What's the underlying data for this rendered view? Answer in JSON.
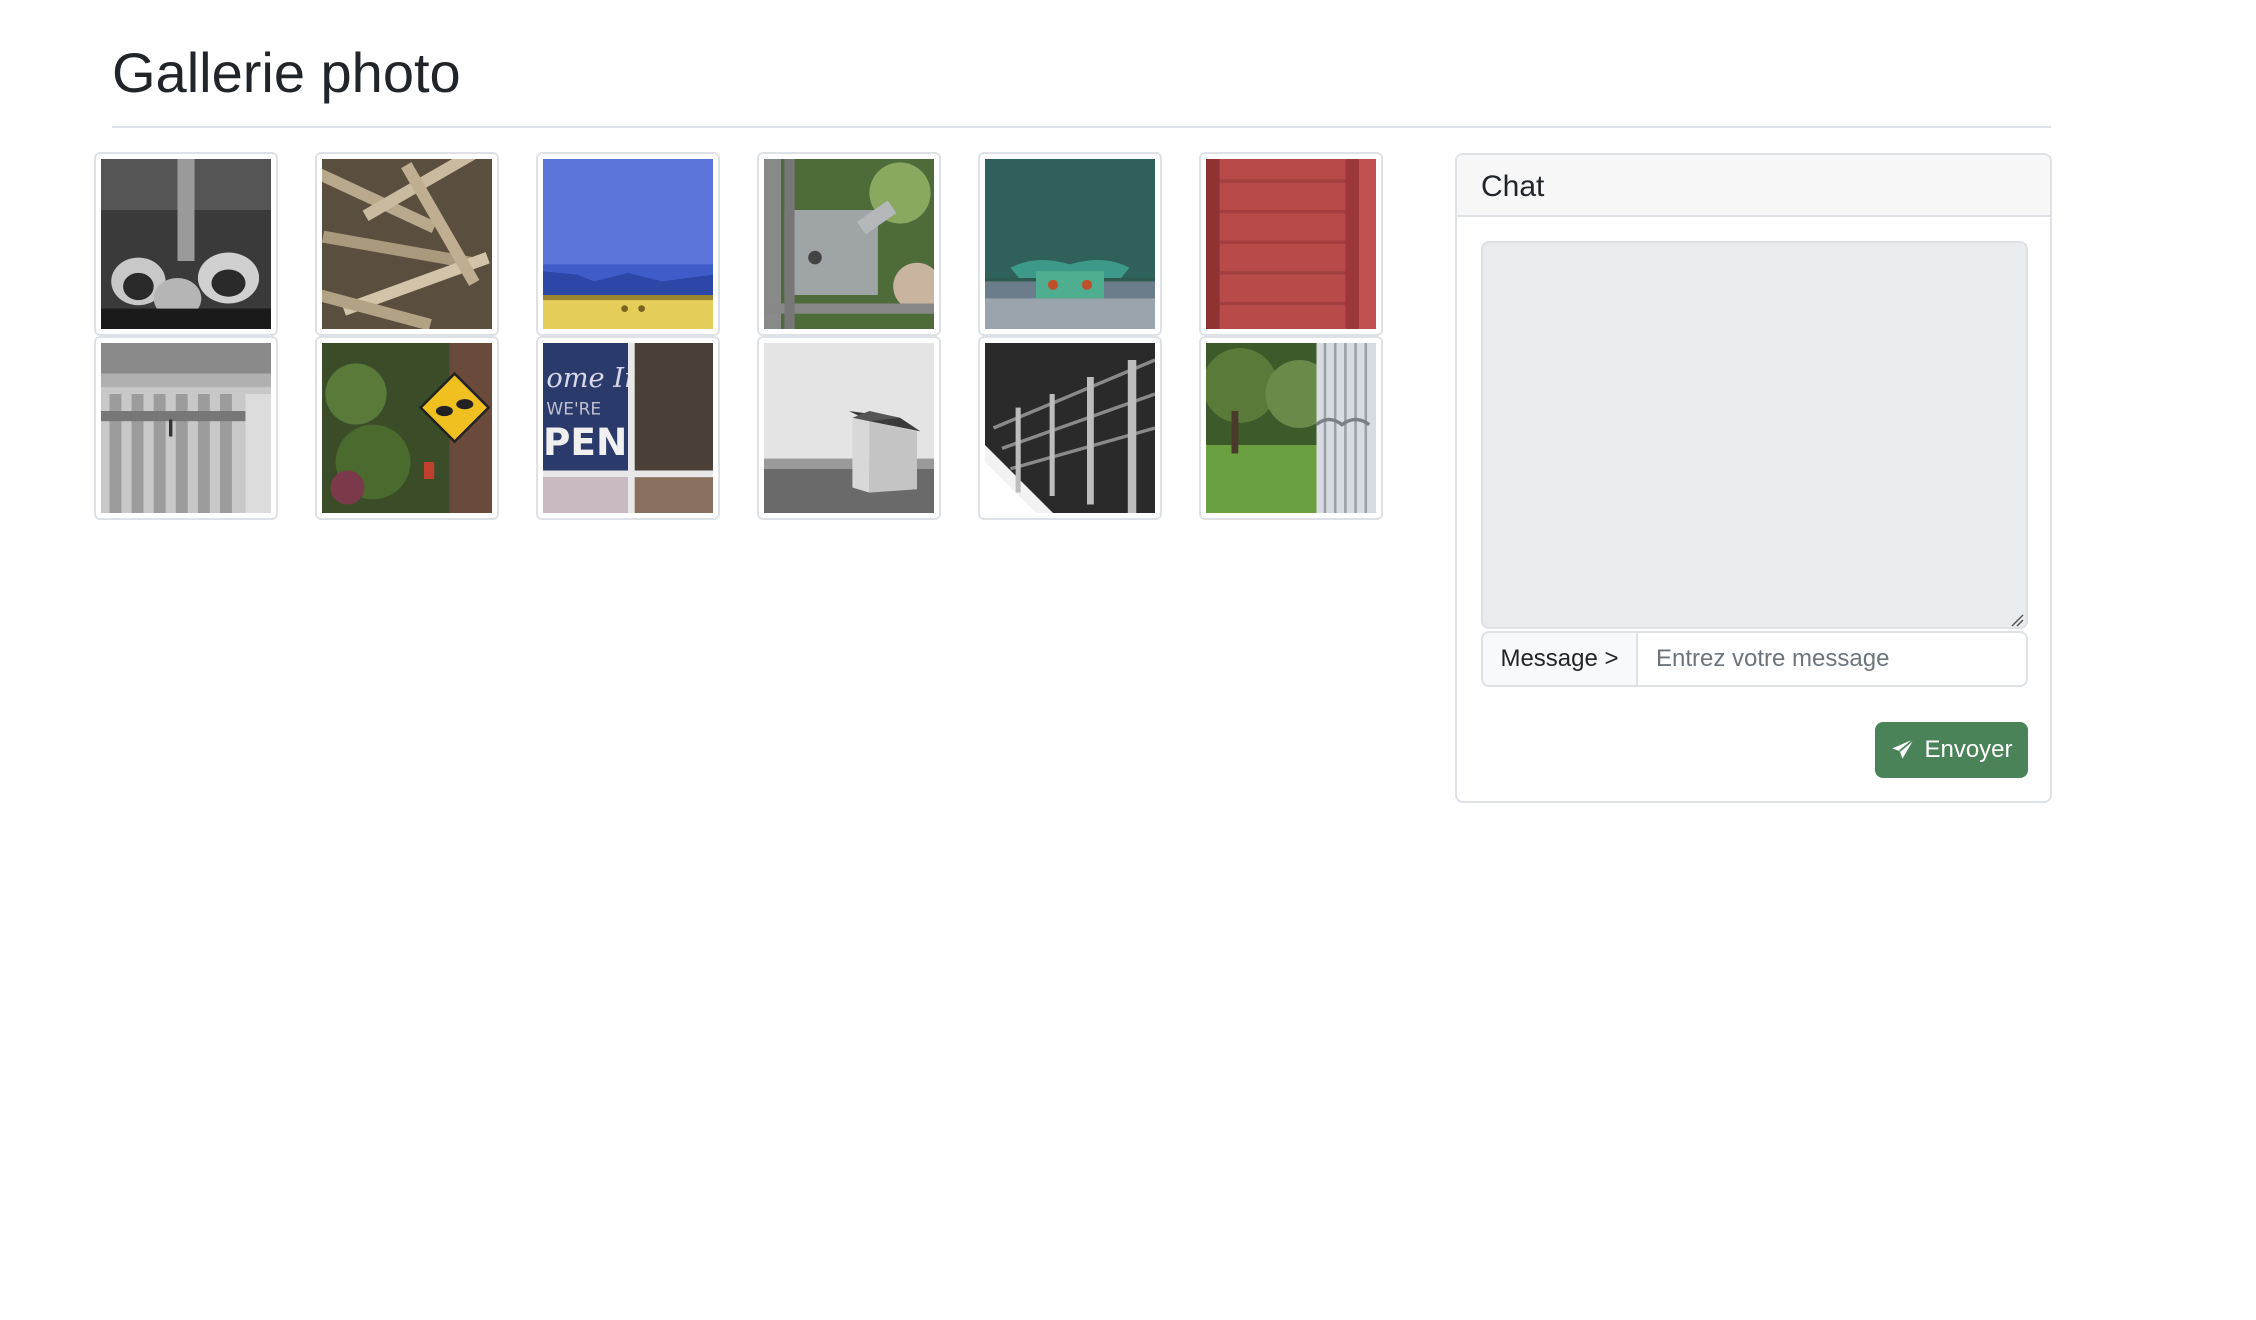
{
  "page": {
    "title": "Gallerie photo"
  },
  "gallery": {
    "photos": [
      "photo-metal-parts-bw",
      "photo-wood-sticks",
      "photo-blue-sky-yellow-structure",
      "photo-gate-latch",
      "photo-boat-cleat",
      "photo-red-shutter",
      "photo-wooden-bench",
      "photo-rabbit-crossing-sign",
      "photo-open-sign-window",
      "photo-beach-hut",
      "photo-snowy-fence",
      "photo-garden-gate"
    ]
  },
  "chat": {
    "title": "Chat",
    "message_label": "Message >",
    "message_placeholder": "Entrez votre message",
    "message_value": "",
    "send_label": "Envoyer",
    "send_icon": "paper-plane-icon",
    "send_color": "#4a8358"
  },
  "colors": {
    "text": "#212529",
    "border": "#dee2e6",
    "chat_log_bg": "#e9ecef",
    "header_bg": "#f7f7f7"
  }
}
